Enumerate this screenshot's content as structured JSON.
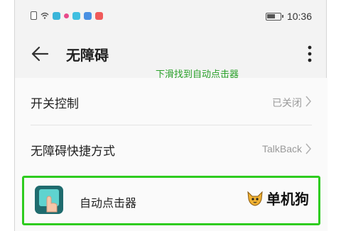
{
  "status_bar": {
    "time": "10:36",
    "icon_colors": [
      "#3ab5d9",
      "#e84a8a",
      "#3fbfe0",
      "#4a90e2",
      "#f05a5a"
    ]
  },
  "toolbar": {
    "title": "无障碍",
    "hint": "下滑找到自动点击器"
  },
  "list": {
    "items": [
      {
        "label": "开关控制",
        "value": "已关闭"
      },
      {
        "label": "无障碍快捷方式",
        "value": "TalkBack"
      },
      {
        "label": "自动点击器"
      }
    ]
  },
  "watermark": {
    "text": "单机狗"
  },
  "colors": {
    "highlight": "#2ecc1f",
    "hint": "#2aa12a"
  }
}
